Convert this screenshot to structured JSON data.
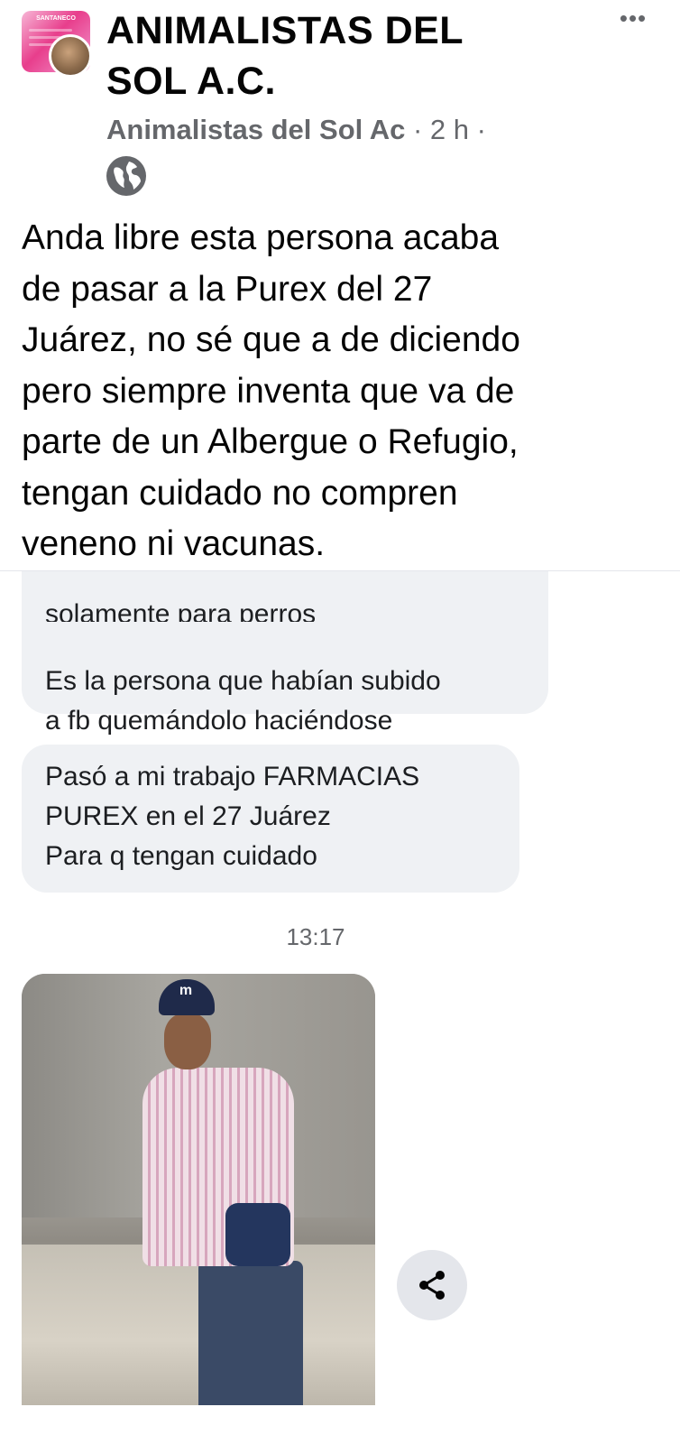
{
  "post": {
    "group_name": "ANIMALISTAS DEL\nSOL A.C.",
    "author": "Animalistas del Sol Ac",
    "time": " · 2 h · ",
    "text": "Anda libre esta persona acaba\nde pasar a la Purex del 27\nJuárez, no sé que a de diciendo\npero siempre inventa que va de\nparte de un Albergue o Refugio,\ntengan cuidado no compren\nveneno ni vacunas.",
    "privacy_icon": "globe-icon",
    "more_icon": "more-icon",
    "more_label": "•••",
    "group_avatar_banner": "SANTANECO"
  },
  "chat": {
    "bubble_1_cut": "solamente para perros",
    "bubble_1": "Es la persona que habían subido\na fb quemándolo haciéndose\npasar por animalistas del sol !!",
    "bubble_2": "Pasó a mi trabajo FARMACIAS\nPUREX en el 27 Juárez\nPara q tengan cuidado",
    "timestamp": "13:17",
    "photo_cap_logo": "m",
    "share_icon": "share-icon"
  },
  "colors": {
    "text": "#050505",
    "meta": "#65676b",
    "bubble": "#eff1f4",
    "share_bg": "#e4e6eb"
  }
}
